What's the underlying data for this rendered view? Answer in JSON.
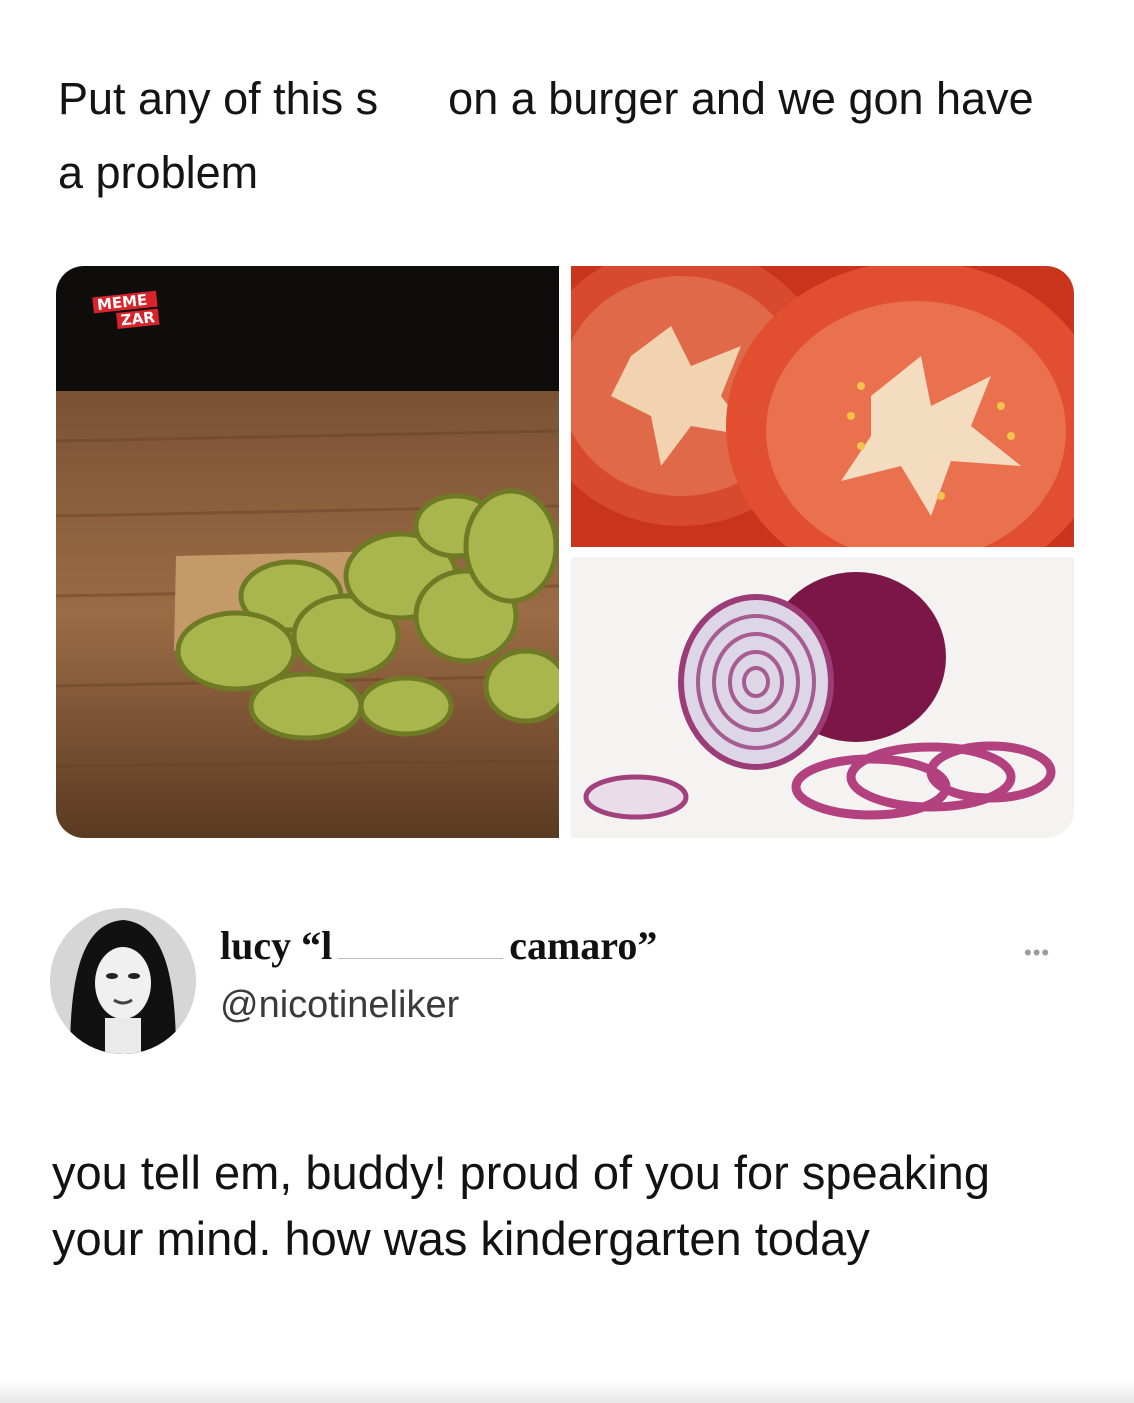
{
  "quoted_tweet": {
    "text_part1": "Put any of this s",
    "text_part2": "on a burger and we gon have a problem",
    "watermark": {
      "line1": "MEME",
      "line2": "ZAR"
    },
    "images": [
      "pickle-slices",
      "tomato-slices",
      "red-onion"
    ]
  },
  "reply_tweet": {
    "author_name_part1": "lucy “l",
    "author_name_part2": "camaro”",
    "author_handle": "@nicotineliker",
    "more_label": "•••",
    "text": "you tell em, buddy! proud of you for speaking your mind. how was kindergarten today"
  },
  "colors": {
    "watermark_red": "#d8232a",
    "text": "#121212",
    "handle": "#3a3a3a"
  }
}
